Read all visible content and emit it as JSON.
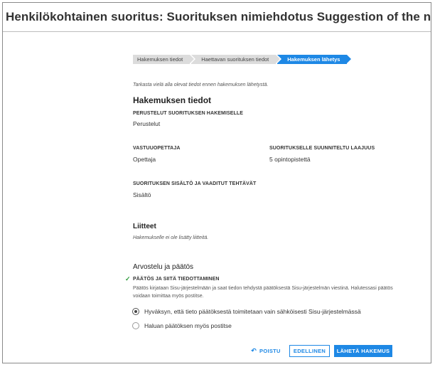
{
  "page_title": "Henkilökohtainen suoritus: Suorituksen nimiehdotus Suggestion of the name for th",
  "steps": [
    {
      "label": "Hakemuksen tiedot",
      "active": false
    },
    {
      "label": "Haettavan suorituksen tiedot",
      "active": false
    },
    {
      "label": "Hakemuksen lähetys",
      "active": true
    }
  ],
  "intro": "Tarkasta vielä alla olevat tiedot ennen hakemuksen lähetystä.",
  "application_info": {
    "title": "Hakemuksen tiedot",
    "justification_label": "PERUSTELUT SUORITUKSEN HAKEMISELLE",
    "justification_value": "Perustelut",
    "teacher_label": "VASTUUOPETTAJA",
    "teacher_value": "Opettaja",
    "credits_label": "SUORITUKSELLE SUUNNITELTU LAAJUUS",
    "credits_value": "5 opintopistettä",
    "content_label": "SUORITUKSEN SISÄLTÖ JA VAADITUT TEHTÄVÄT",
    "content_value": "Sisältö"
  },
  "attachments": {
    "title": "Liitteet",
    "empty_text": "Hakemukselle ei ole lisätty liitteitä."
  },
  "decision": {
    "title": "Arvostelu ja päätös",
    "subtitle": "PÄÄTÖS JA SIITÄ TIEDOTTAMINEN",
    "description": "Päätös kirjataan Sisu-järjestelmään ja saat tiedon tehdystä päätöksestä Sisu-järjestelmän viestinä. Halutessasi päätös voidaan toimittaa myös postitse.",
    "options": [
      {
        "label": "Hyväksyn, että tieto päätöksestä toimitetaan vain sähköisesti Sisu-järjestelmässä",
        "selected": true
      },
      {
        "label": "Haluan päätöksen myös postitse",
        "selected": false
      }
    ]
  },
  "buttons": {
    "remove": "POISTU",
    "previous": "EDELLINEN",
    "send": "LÄHETÄ HAKEMUS"
  },
  "colors": {
    "accent": "#1e88e5",
    "check": "#2e9b3c"
  }
}
